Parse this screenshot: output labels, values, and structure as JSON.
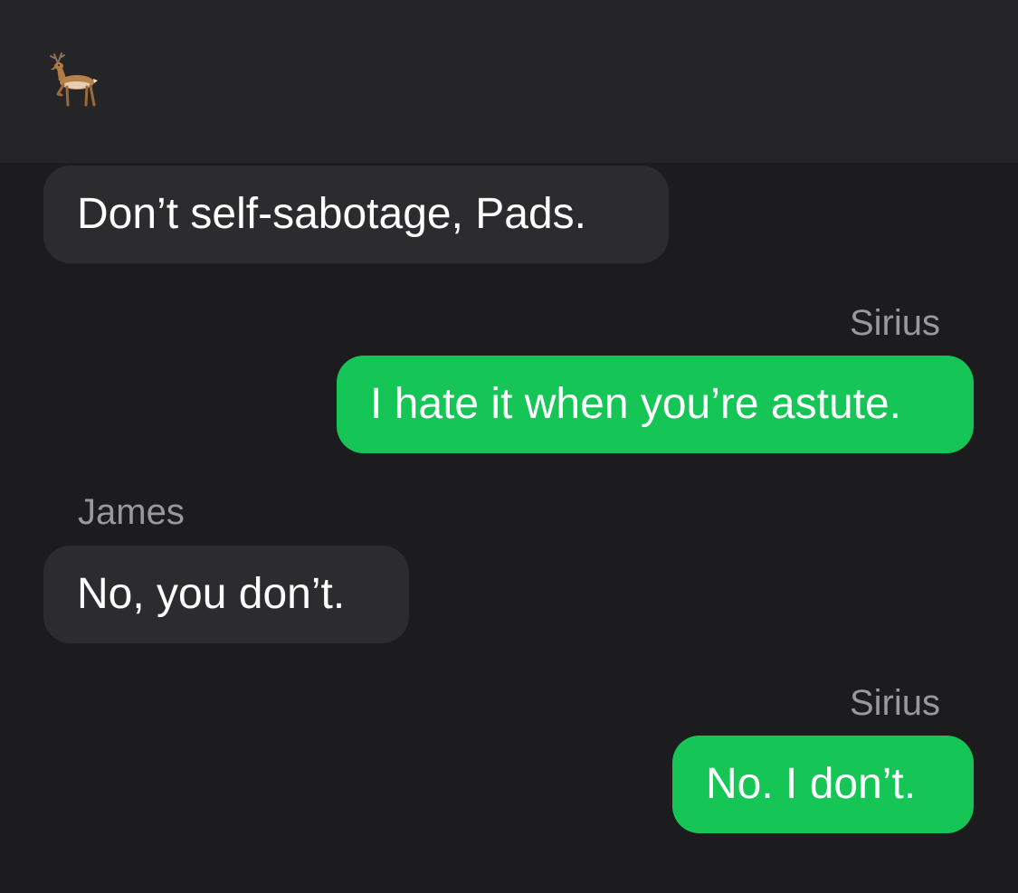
{
  "header": {
    "icon": "deer-icon"
  },
  "messages": [
    {
      "direction": "incoming",
      "sender": "",
      "text": "Don’t self-sabotage, Pads."
    },
    {
      "direction": "outgoing",
      "sender": "Sirius",
      "text": "I hate it when you’re astute."
    },
    {
      "direction": "incoming",
      "sender": "James",
      "text": "No, you don’t."
    },
    {
      "direction": "outgoing",
      "sender": "Sirius",
      "text": "No. I don’t."
    }
  ],
  "colors": {
    "background": "#1c1c1e",
    "header": "#252527",
    "incoming_bubble": "#2c2c2e",
    "outgoing_bubble": "#15c556",
    "sender_label": "#98989d",
    "text": "#ffffff"
  }
}
